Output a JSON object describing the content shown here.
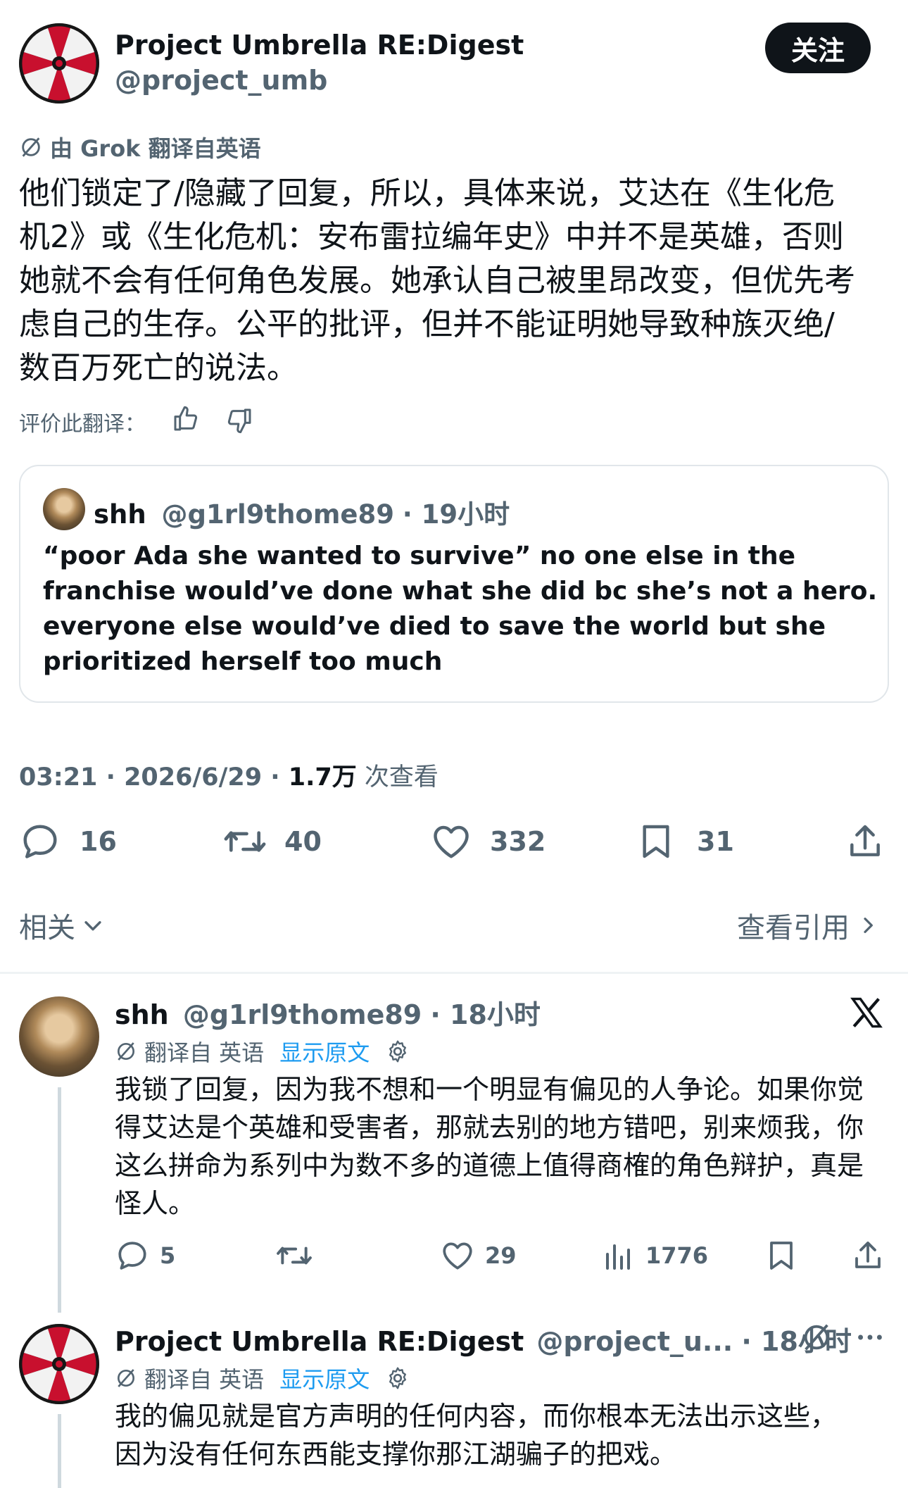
{
  "main_post": {
    "author_name": "Project Umbrella RE:Digest",
    "author_handle": "@project_umb",
    "follow_label": "关注",
    "translate_note": "由 Grok 翻译自英语",
    "text_lines": [
      "他们锁定了/隐藏了回复，所以，具体来说，艾达在《生化危",
      "机2》或《生化危机：安布雷拉编年史》中并不是英雄，否则",
      "她就不会有任何角色发展。她承认自己被里昂改变，但优先考",
      "虑自己的生存。公平的批评，但并不能证明她导致种族灭绝/",
      "数百万死亡的说法。"
    ],
    "rate_label": "评价此翻译：",
    "quote": {
      "name": "shh",
      "handle": "@g1rl9thome89",
      "time": "· 19小时",
      "text_lines": [
        "“poor Ada she wanted to survive” no one else in the",
        "franchise would’ve done what she did bc she’s not a hero.",
        "everyone else would’ve died to save the world but she",
        "prioritized herself too much"
      ]
    },
    "meta_time": "03:21 · 2026/6/29 · ",
    "meta_views": "1.7万",
    "meta_views_label": " 次查看",
    "stats": {
      "replies": "16",
      "reposts": "40",
      "likes": "332",
      "bookmarks": "31"
    }
  },
  "related": {
    "label": "相关",
    "view_quotes": "查看引用"
  },
  "replies": [
    {
      "name": "shh",
      "handle": "@g1rl9thome89",
      "time": "· 18小时",
      "translate_note": "翻译自 英语",
      "show_original": "显示原文",
      "text_lines": [
        "我锁了回复，因为我不想和一个明显有偏见的人争论。如果你觉",
        "得艾达是个英雄和受害者，那就去别的地方错吧，别来烦我，你",
        "这么拼命为系列中为数不多的道德上值得商榷的角色辩护，真是",
        "怪人。"
      ],
      "stats": {
        "replies": "5",
        "likes": "29",
        "views": "1776"
      }
    },
    {
      "name": "Project Umbrella RE:Digest",
      "handle": "@project_u...",
      "time": "· 18小时",
      "translate_note": "翻译自 英语",
      "show_original": "显示原文",
      "text_lines": [
        "我的偏见就是官方声明的任何内容，而你根本无法出示这些，",
        "因为没有任何东西能支撑你那江湖骗子的把戏。"
      ]
    }
  ],
  "colors": {
    "text": "#0f1419",
    "secondary": "#536471",
    "link": "#1d9bf0",
    "border": "#e1e6ea"
  }
}
